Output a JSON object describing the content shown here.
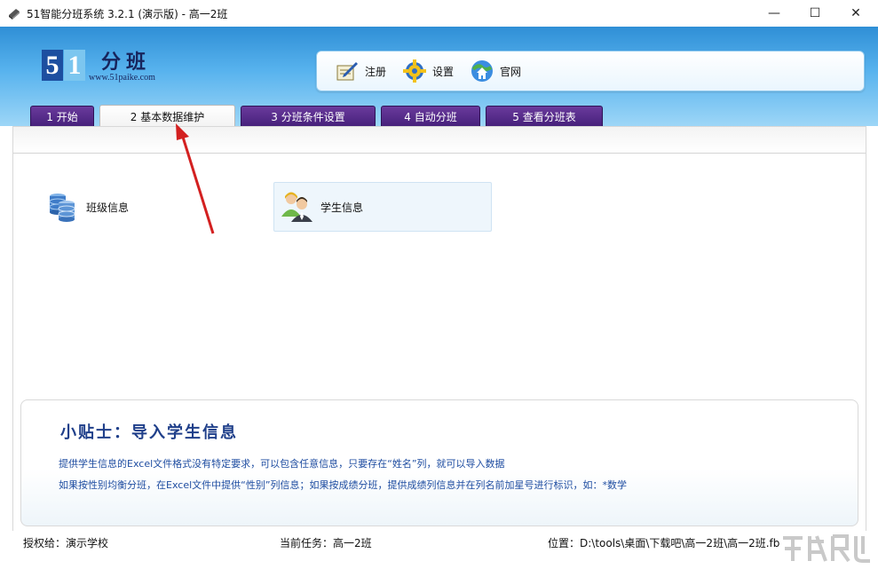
{
  "window": {
    "title": "51智能分班系统 3.2.1 (演示版) - 高一2班",
    "minimize_glyph": "—",
    "maximize_glyph": "☐",
    "close_glyph": "✕"
  },
  "header": {
    "logo_digit1": "5",
    "logo_digit2": "1",
    "logo_title": "分班",
    "logo_url": "www.51paike.com",
    "tools": [
      {
        "label": "注册",
        "icon": "register-icon"
      },
      {
        "label": "设置",
        "icon": "gear-icon"
      },
      {
        "label": "官网",
        "icon": "home-globe-icon"
      }
    ]
  },
  "tabs": [
    {
      "label": "1 开始",
      "active": false
    },
    {
      "label": "2 基本数据维护",
      "active": true
    },
    {
      "label": "3 分班条件设置",
      "active": false
    },
    {
      "label": "4 自动分班",
      "active": false
    },
    {
      "label": "5 查看分班表",
      "active": false
    }
  ],
  "content": {
    "items": [
      {
        "label": "班级信息",
        "icon": "database-icon"
      },
      {
        "label": "学生信息",
        "icon": "users-icon"
      }
    ]
  },
  "tips": {
    "title": "小贴士：导入学生信息",
    "line1": "提供学生信息的Excel文件格式没有特定要求，可以包含任意信息，只要存在“姓名”列，就可以导入数据",
    "line2": "如果按性别均衡分班，在Excel文件中提供“性别”列信息；如果按成绩分班，提供成绩列信息并在列名前加星号进行标识，如：*数学"
  },
  "status": {
    "license": "授权给：演示学校",
    "task": "当前任务：高一2班",
    "location": "位置：D:\\tools\\桌面\\下载吧\\高一2班\\高一2班.fb"
  },
  "colors": {
    "header_top": "#2f8fd6",
    "tab_inactive": "#45207a",
    "tips_text": "#1f4da1",
    "annotation_arrow": "#d32020"
  }
}
